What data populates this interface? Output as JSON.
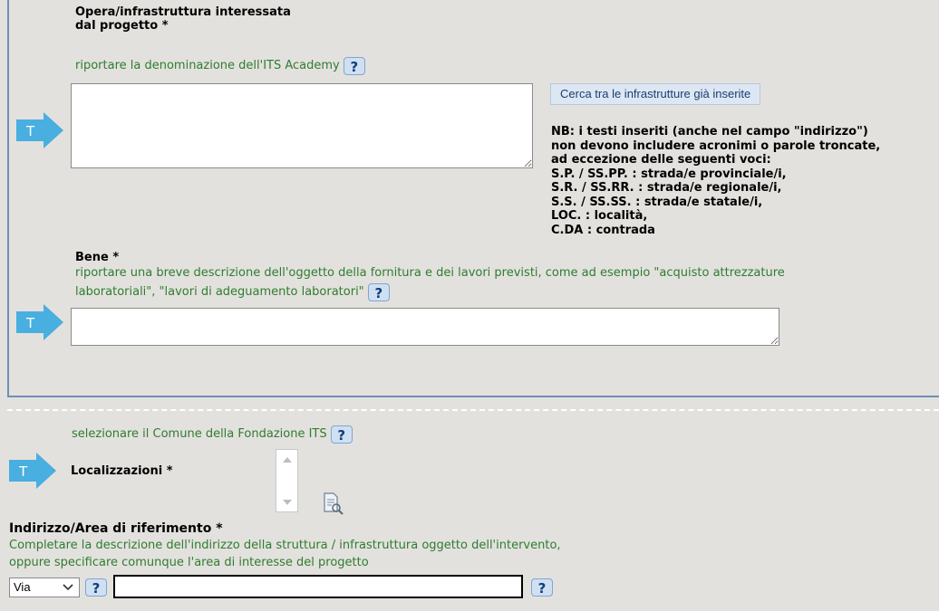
{
  "opera": {
    "label_line1": "Opera/infrastruttura interessata",
    "label_line2": "dal progetto *",
    "hint": "riportare la denominazione dell'ITS Academy",
    "search_button": "Cerca tra le infrastrutture già inserite",
    "nb_lines": [
      "NB: i testi inseriti (anche nel campo \"indirizzo\")",
      "non devono includere acronimi o parole troncate,",
      "ad eccezione delle seguenti voci:",
      "S.P. / SS.PP. : strada/e provinciale/i,",
      "S.R. / SS.RR. : strada/e regionale/i,",
      "S.S. / SS.SS. : strada/e statale/i,",
      "LOC. : località,",
      "C.DA : contrada"
    ]
  },
  "bene": {
    "label": "Bene *",
    "hint_line1": "riportare una breve descrizione dell'oggetto della fornitura e dei lavori previsti, come ad esempio \"acquisto attrezzature",
    "hint_line2": "laboratoriali\", \"lavori di adeguamento laboratori\""
  },
  "localizzazioni": {
    "hint": "selezionare il Comune della Fondazione ITS",
    "label": "Localizzazioni *"
  },
  "indirizzo": {
    "label": "Indirizzo/Area di riferimento *",
    "hint_line1": "Completare la descrizione dell'indirizzo della struttura / infrastruttura oggetto dell'intervento,",
    "hint_line2": "oppure specificare comunque l'area di interesse del progetto",
    "select_value": "Via"
  },
  "help_glyph": "?",
  "t_glyph": "T",
  "colors": {
    "hint_green": "#2e7d2e",
    "arrow_blue": "#49aee0",
    "panel_border": "#6b8fb8"
  }
}
